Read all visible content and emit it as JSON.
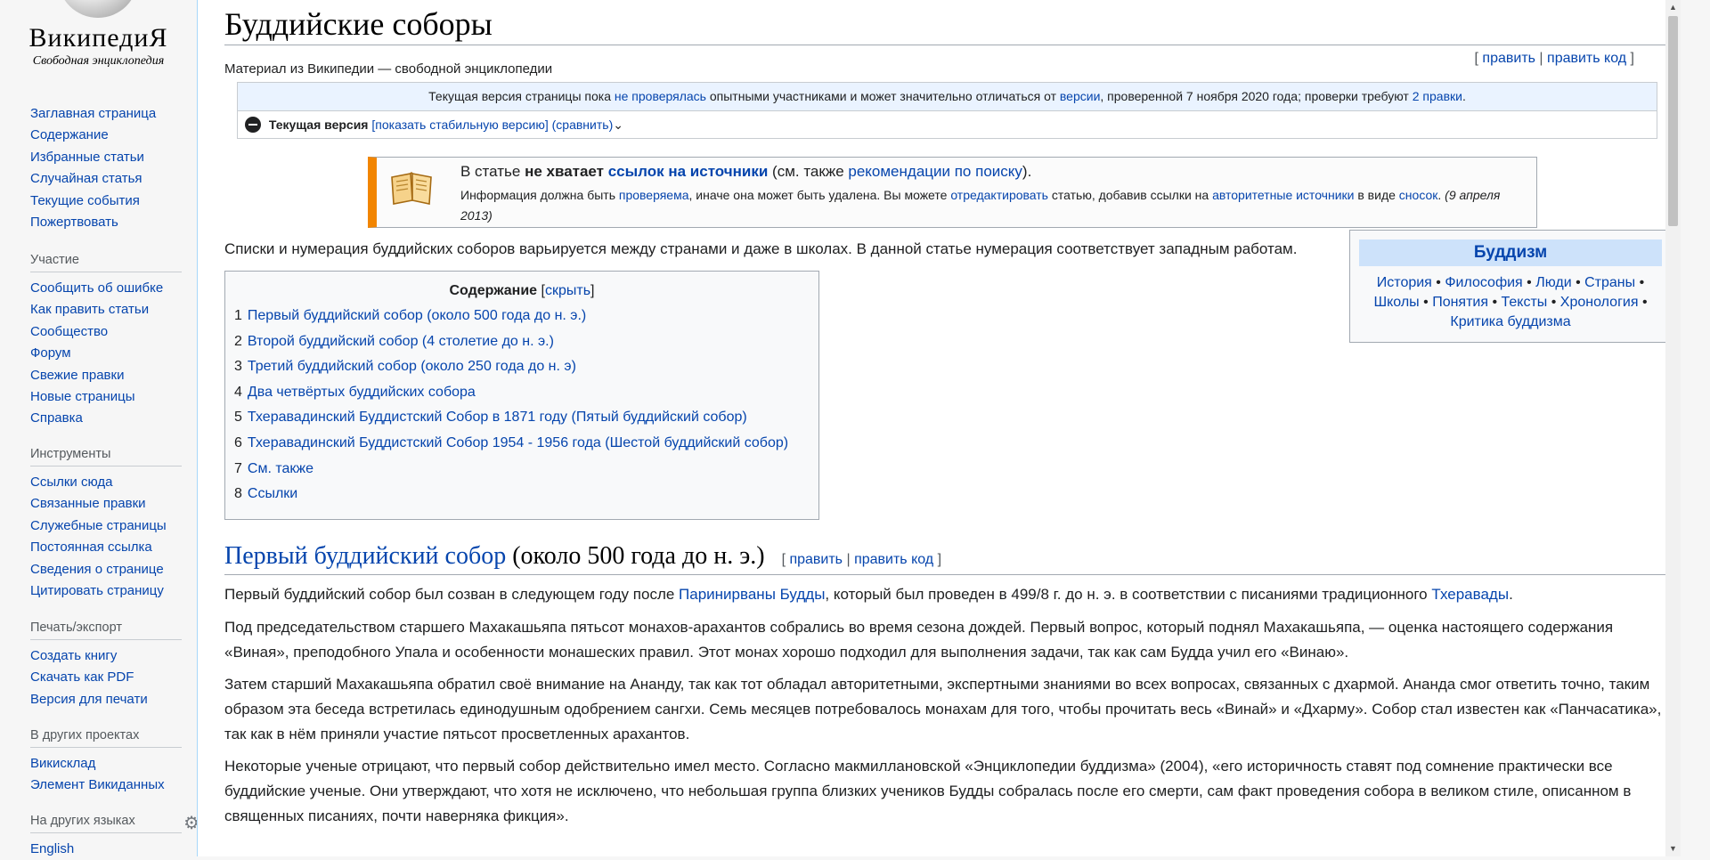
{
  "logo": {
    "wordmark": "ВикипедиЯ",
    "tagline": "Свободная энциклопедия"
  },
  "nav": {
    "main": [
      "Заглавная страница",
      "Содержание",
      "Избранные статьи",
      "Случайная статья",
      "Текущие события",
      "Пожертвовать"
    ],
    "participation_heading": "Участие",
    "participation": [
      "Сообщить об ошибке",
      "Как править статьи",
      "Сообщество",
      "Форум",
      "Свежие правки",
      "Новые страницы",
      "Справка"
    ],
    "tools_heading": "Инструменты",
    "tools": [
      "Ссылки сюда",
      "Связанные правки",
      "Служебные страницы",
      "Постоянная ссылка",
      "Сведения о странице",
      "Цитировать страницу"
    ],
    "print_heading": "Печать/экспорт",
    "print": [
      "Создать книгу",
      "Скачать как PDF",
      "Версия для печати"
    ],
    "projects_heading": "В других проектах",
    "projects": [
      "Викисклад",
      "Элемент Викиданных"
    ],
    "languages_heading": "На других языках",
    "languages": [
      "English"
    ]
  },
  "page": {
    "title": "Буддийские соборы",
    "subtitle": "Материал из Википедии — свободной энциклопедии",
    "edit": "править",
    "edit_code": "править код"
  },
  "flagged": {
    "pre": "Текущая версия страницы пока ",
    "not_checked": "не проверялась",
    "mid": " опытными участниками и может значительно отличаться от ",
    "version": "версии",
    "post": ", проверенной 7 ноября 2020 года; проверки требуют ",
    "edits": "2 правки",
    "current": "Текущая версия",
    "show_stable": "показать стабильную версию",
    "compare": "сравнить"
  },
  "ambox": {
    "t1_pre": "В статье ",
    "t1_bold": "не хватает",
    "t1_link": "ссылок на источники",
    "t1_mid": " (см. также ",
    "t1_link2": "рекомендации по поиску",
    "t1_end": ").",
    "t2_pre": "Информация должна быть ",
    "t2_link1": "проверяема",
    "t2_mid1": ", иначе она может быть удалена. Вы можете ",
    "t2_link2": "отредактировать",
    "t2_mid2": " статью, добавив ссылки на ",
    "t2_link3": "авторитетные источники",
    "t2_mid3": " в виде ",
    "t2_link4": "сносок",
    "t2_date": "(9 апреля 2013)"
  },
  "intro": "Списки и нумерация буддийских соборов варьируется между странами и даже в школах. В данной статье нумерация соответствует западным работам.",
  "navbox": {
    "title": "Буддизм",
    "links": [
      "История",
      "Философия",
      "Люди",
      "Страны",
      "Школы",
      "Понятия",
      "Тексты",
      "Хронология",
      "Критика буддизма"
    ]
  },
  "toc": {
    "title": "Содержание",
    "hide": "скрыть",
    "items": [
      {
        "num": "1",
        "text": "Первый буддийский собор (около 500 года до н. э.)"
      },
      {
        "num": "2",
        "text": "Второй буддийский собор (4 столетие до н. э.)"
      },
      {
        "num": "3",
        "text": "Третий буддийский собор (около 250 года до н. э)"
      },
      {
        "num": "4",
        "text": "Два четвёртых буддийских собора"
      },
      {
        "num": "5",
        "text": "Тхеравадинский Буддистский Собор в 1871 году (Пятый буддийский собор)"
      },
      {
        "num": "6",
        "text": "Тхеравадинский Буддистский Собор 1954 - 1956 года (Шестой буддийский собор)"
      },
      {
        "num": "7",
        "text": "См. также"
      },
      {
        "num": "8",
        "text": "Ссылки"
      }
    ]
  },
  "section1": {
    "title_link": "Первый буддийский собор",
    "title_rest": " (около 500 года до н. э.)",
    "edit": "править",
    "edit_code": "править код",
    "p1_pre": "Первый буддийский собор был созван в следующем году после ",
    "p1_link1": "Паринирваны Будды",
    "p1_mid": ", который был проведен в 499/8 г. до н. э. в соответствии с писаниями традиционного ",
    "p1_link2": "Тхеравады",
    "p1_end": ".",
    "p2": "Под председательством старшего Махакашьяпа пятьсот монахов-арахантов собрались во время сезона дождей. Первый вопрос, который поднял Махакашьяпа, — оценка настоящего содержания «Виная», преподобного Упала и особенности монашеских правил. Этот монах хорошо подходил для выполнения задачи, так как сам Будда учил его «Винаю».",
    "p3": "Затем старший Махакашьяпа обратил своё внимание на Ананду, так как тот обладал авторитетными, экспертными знаниями во всех вопросах, связанных с дхармой. Ананда смог ответить точно, таким образом эта беседа встретилась единодушным одобрением сангхи. Семь месяцев потребовалось монахам для того, чтобы прочитать весь «Винай» и «Дхарму». Собор стал известен как «Панчасатика», так как в нём приняли участие пятьсот просветленных арахантов.",
    "p4": "Некоторые ученые отрицают, что первый собор действительно имел место. Согласно макмиллановской «Энциклопедии буддизма» (2004), «его историчность ставят под сомнение практически все буддийские ученые. Они утверждают, что хотя не исключено, что небольшая группа близких учеников Будды собралась после его смерти, сам факт проведения собора в великом стиле, описанном в священных писаниях, почти наверняка фикция»."
  }
}
